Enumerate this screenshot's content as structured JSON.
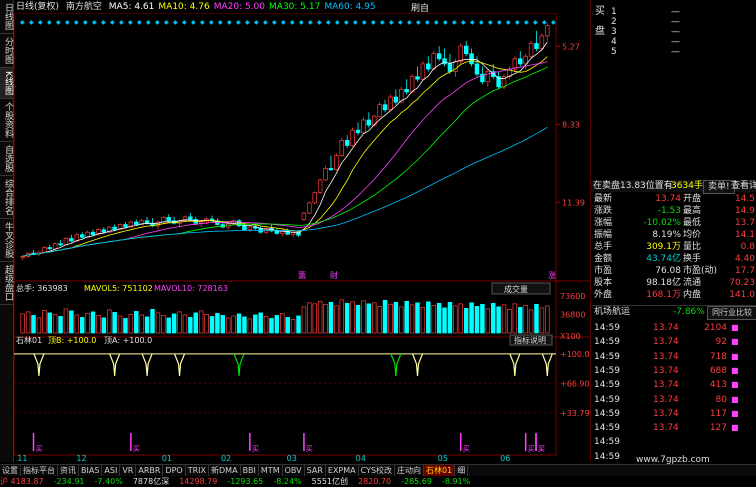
{
  "window": {
    "title": "日线(复权)",
    "stock_name": "南方航空",
    "refresh_label": "刷自"
  },
  "side_tabs": [
    "日线图",
    "分时图",
    "K线图",
    "个股资料",
    "自选股",
    "综合排名",
    "牛叉诊股",
    "超级盘口"
  ],
  "ma_legend": [
    {
      "label": "MA5: 4.61",
      "color": "#ffffff"
    },
    {
      "label": "MA10: 4.76",
      "color": "#ffff00"
    },
    {
      "label": "MA20: 5.00",
      "color": "#ff40ff"
    },
    {
      "label": "MA30: 5.17",
      "color": "#00ff00"
    },
    {
      "label": "MA60: 4.95",
      "color": "#00c0ff"
    }
  ],
  "volume_legend": {
    "total": "总手: 363983",
    "mavol5": "MAVOL5: 751102",
    "mavol10": "MAVOL10: 728163",
    "vol_btn": "成交量"
  },
  "indicator_legend": {
    "name": "石林01",
    "bottom": "顶B: +100.0",
    "top": "顶A: +100.0",
    "explain_btn": "指标说明"
  },
  "price_axis": [
    "11.39",
    "8.33",
    "5.27"
  ],
  "vol_axis": [
    "73600",
    "36800",
    "X100"
  ],
  "ind_axis": [
    "+100.0",
    "+66.90",
    "+33.79"
  ],
  "month_labels": [
    "11",
    "12",
    "01",
    "02",
    "03",
    "04",
    "05",
    "06"
  ],
  "event_marks": [
    {
      "label": "籌"
    },
    {
      "label": "财"
    },
    {
      "label": "涨"
    }
  ],
  "buy_marks": [
    "买",
    "买",
    "买",
    "买",
    "买",
    "买",
    "买",
    "买"
  ],
  "chart_data": [
    {
      "type": "candlestick",
      "title": "",
      "ylim": [
        2.5,
        12.5
      ],
      "ticks": [
        5.27,
        8.33,
        11.39
      ],
      "values": [
        [
          3.1,
          3.2,
          3.0,
          3.15
        ],
        [
          3.15,
          3.3,
          3.1,
          3.28
        ],
        [
          3.28,
          3.4,
          3.2,
          3.25
        ],
        [
          3.25,
          3.35,
          3.18,
          3.32
        ],
        [
          3.32,
          3.55,
          3.3,
          3.5
        ],
        [
          3.5,
          3.6,
          3.4,
          3.45
        ],
        [
          3.45,
          3.7,
          3.42,
          3.65
        ],
        [
          3.65,
          3.8,
          3.55,
          3.6
        ],
        [
          3.6,
          3.9,
          3.58,
          3.85
        ],
        [
          3.85,
          4.0,
          3.7,
          3.75
        ],
        [
          3.75,
          4.05,
          3.72,
          4.0
        ],
        [
          4.0,
          4.1,
          3.85,
          3.9
        ],
        [
          3.9,
          4.15,
          3.88,
          4.1
        ],
        [
          4.1,
          4.2,
          3.95,
          4.0
        ],
        [
          4.0,
          4.25,
          3.98,
          4.2
        ],
        [
          4.2,
          4.3,
          4.05,
          4.1
        ],
        [
          4.1,
          4.35,
          4.08,
          4.3
        ],
        [
          4.3,
          4.4,
          4.15,
          4.2
        ],
        [
          4.2,
          4.45,
          4.18,
          4.4
        ],
        [
          4.4,
          4.5,
          4.25,
          4.3
        ],
        [
          4.3,
          4.55,
          4.28,
          4.5
        ],
        [
          4.5,
          4.6,
          4.35,
          4.4
        ],
        [
          4.4,
          4.62,
          4.38,
          4.55
        ],
        [
          4.55,
          4.7,
          4.4,
          4.45
        ],
        [
          4.45,
          4.65,
          4.3,
          4.35
        ],
        [
          4.35,
          4.55,
          4.2,
          4.5
        ],
        [
          4.5,
          4.72,
          4.45,
          4.68
        ],
        [
          4.68,
          4.8,
          4.5,
          4.55
        ],
        [
          4.55,
          4.7,
          4.4,
          4.45
        ],
        [
          4.45,
          4.6,
          4.3,
          4.55
        ],
        [
          4.55,
          4.75,
          4.5,
          4.7
        ],
        [
          4.7,
          4.85,
          4.55,
          4.6
        ],
        [
          4.6,
          4.7,
          4.4,
          4.45
        ],
        [
          4.45,
          4.58,
          4.3,
          4.5
        ],
        [
          4.5,
          4.68,
          4.42,
          4.62
        ],
        [
          4.62,
          4.75,
          4.5,
          4.55
        ],
        [
          4.55,
          4.65,
          4.35,
          4.4
        ],
        [
          4.4,
          4.55,
          4.25,
          4.3
        ],
        [
          4.3,
          4.48,
          4.2,
          4.42
        ],
        [
          4.42,
          4.6,
          4.38,
          4.55
        ],
        [
          4.55,
          4.62,
          4.3,
          4.35
        ],
        [
          4.35,
          4.45,
          4.15,
          4.2
        ],
        [
          4.2,
          4.38,
          4.1,
          4.3
        ],
        [
          4.3,
          4.45,
          4.18,
          4.25
        ],
        [
          4.25,
          4.35,
          4.05,
          4.1
        ],
        [
          4.1,
          4.3,
          4.02,
          4.25
        ],
        [
          4.25,
          4.4,
          4.1,
          4.15
        ],
        [
          4.15,
          4.28,
          4.0,
          4.05
        ],
        [
          4.05,
          4.2,
          3.95,
          4.15
        ],
        [
          4.15,
          4.25,
          3.98,
          4.02
        ],
        [
          4.02,
          4.15,
          3.9,
          4.1
        ],
        [
          4.1,
          4.18,
          3.92,
          3.98
        ],
        [
          4.6,
          4.9,
          4.55,
          4.85
        ],
        [
          4.85,
          5.3,
          4.8,
          5.25
        ],
        [
          5.25,
          5.7,
          5.2,
          5.65
        ],
        [
          5.65,
          6.2,
          5.6,
          6.15
        ],
        [
          6.15,
          6.7,
          6.1,
          6.6
        ],
        [
          6.6,
          7.1,
          6.5,
          6.55
        ],
        [
          6.55,
          7.2,
          6.5,
          7.1
        ],
        [
          7.1,
          7.8,
          7.05,
          7.7
        ],
        [
          7.7,
          7.9,
          7.4,
          7.5
        ],
        [
          7.5,
          8.2,
          7.45,
          8.1
        ],
        [
          8.1,
          8.4,
          7.9,
          8.0
        ],
        [
          8.0,
          8.6,
          7.95,
          8.5
        ],
        [
          8.5,
          8.8,
          8.2,
          8.3
        ],
        [
          8.3,
          8.7,
          8.25,
          8.65
        ],
        [
          8.65,
          9.2,
          8.6,
          9.1
        ],
        [
          9.1,
          9.3,
          8.8,
          8.9
        ],
        [
          8.9,
          9.5,
          8.85,
          9.4
        ],
        [
          9.4,
          9.7,
          9.1,
          9.2
        ],
        [
          9.2,
          9.8,
          9.15,
          9.7
        ],
        [
          9.7,
          10.1,
          9.5,
          9.6
        ],
        [
          9.6,
          10.3,
          9.55,
          10.2
        ],
        [
          10.2,
          10.6,
          10.0,
          10.1
        ],
        [
          10.1,
          10.8,
          10.05,
          10.7
        ],
        [
          10.7,
          11.0,
          10.4,
          10.5
        ],
        [
          10.5,
          11.2,
          10.45,
          11.1
        ],
        [
          11.1,
          11.4,
          10.8,
          10.9
        ],
        [
          10.9,
          11.3,
          10.6,
          10.7
        ],
        [
          10.7,
          11.1,
          10.3,
          10.4
        ],
        [
          10.4,
          10.9,
          10.2,
          10.8
        ],
        [
          10.8,
          11.5,
          10.7,
          11.4
        ],
        [
          11.4,
          11.6,
          11.0,
          11.1
        ],
        [
          11.1,
          11.3,
          10.6,
          10.7
        ],
        [
          10.7,
          11.0,
          10.2,
          10.3
        ],
        [
          10.3,
          10.6,
          9.9,
          10.0
        ],
        [
          10.0,
          10.5,
          9.8,
          10.4
        ],
        [
          10.4,
          10.7,
          10.1,
          10.2
        ],
        [
          10.2,
          10.4,
          9.7,
          9.8
        ],
        [
          9.8,
          10.3,
          9.7,
          10.2
        ],
        [
          10.2,
          10.6,
          10.1,
          10.5
        ],
        [
          10.5,
          11.0,
          10.4,
          10.9
        ],
        [
          10.9,
          11.2,
          10.6,
          10.7
        ],
        [
          10.7,
          11.1,
          10.5,
          11.0
        ],
        [
          11.0,
          11.6,
          10.9,
          11.5
        ],
        [
          11.5,
          12.0,
          11.2,
          11.3
        ],
        [
          11.3,
          11.9,
          11.2,
          11.8
        ],
        [
          11.8,
          12.3,
          11.6,
          12.2
        ]
      ]
    },
    {
      "type": "bar",
      "title": "",
      "ylim": [
        0,
        73600
      ],
      "ticks": [
        36800,
        73600
      ],
      "values": [
        38000,
        42000,
        35000,
        30000,
        45000,
        40000,
        37000,
        33000,
        48000,
        44000,
        36000,
        31000,
        39000,
        42000,
        35000,
        30000,
        46000,
        41000,
        34000,
        29000,
        37000,
        43000,
        36000,
        32000,
        47000,
        40000,
        35000,
        30000,
        38000,
        42000,
        36000,
        31000,
        40000,
        44000,
        37000,
        33000,
        39000,
        35000,
        30000,
        34000,
        38000,
        32000,
        28000,
        36000,
        40000,
        33000,
        29000,
        35000,
        39000,
        31000,
        27000,
        34000,
        52000,
        60000,
        58000,
        63000,
        57000,
        61000,
        54000,
        66000,
        59000,
        62000,
        55000,
        64000,
        58000,
        60000,
        53000,
        65000,
        57000,
        61000,
        52000,
        63000,
        56000,
        60000,
        51000,
        62000,
        55000,
        59000,
        50000,
        61000,
        54000,
        58000,
        49000,
        60000,
        53000,
        57000,
        48000,
        59000,
        52000,
        56000,
        47000,
        58000,
        51000,
        55000,
        46000,
        57000,
        50000,
        54000
      ]
    },
    {
      "type": "line",
      "title": "",
      "ylim": [
        0,
        110
      ],
      "ticks": [
        33.79,
        66.9,
        100.0
      ],
      "values": [
        100,
        100,
        100,
        100,
        100,
        100,
        100,
        100,
        100,
        100,
        100,
        100,
        100,
        100,
        100,
        100,
        100,
        100,
        100,
        100,
        100,
        100,
        100,
        100,
        100,
        100,
        100,
        100,
        100,
        100,
        100,
        100,
        100,
        100,
        100,
        100,
        100,
        100,
        100,
        100,
        100,
        100,
        100,
        100,
        100,
        100,
        100,
        100,
        100,
        100,
        100,
        100,
        100,
        100,
        100,
        100,
        100,
        100,
        100,
        100,
        100,
        100,
        100,
        100,
        100,
        100,
        100,
        100,
        100,
        100,
        100,
        100,
        100,
        100,
        100,
        100,
        100,
        100,
        100,
        100,
        100,
        100,
        100,
        100,
        100,
        100,
        100,
        100,
        100,
        100,
        100,
        100,
        100,
        100,
        100,
        100,
        100,
        100,
        100,
        100
      ],
      "dips": [
        3,
        17,
        23,
        29,
        40,
        69,
        73,
        91,
        97
      ]
    }
  ],
  "panel": {
    "order_book": [
      {
        "label": "买",
        "n": "1"
      },
      {
        "label": "",
        "n": "2"
      },
      {
        "label": "盘",
        "n": "3"
      },
      {
        "label": "",
        "n": "4"
      },
      {
        "label": "",
        "n": "5"
      }
    ],
    "selling_bar": {
      "left": "在卖盘13.83位置有",
      "qty": "3634手",
      "btn1": "卖单!",
      "btn2": "查看详"
    },
    "stats": [
      {
        "k1": "最新",
        "v1": "13.74",
        "c1": "red",
        "k2": "开盘",
        "v2": "14.5"
      },
      {
        "k1": "涨跌",
        "v1": "-1.53",
        "c1": "grn",
        "k2": "最高",
        "v2": "14.9"
      },
      {
        "k1": "涨幅",
        "v1": "-10.02%",
        "c1": "grn",
        "k2": "最低",
        "v2": "13.7"
      },
      {
        "k1": "振幅",
        "v1": "8.19%",
        "c1": "wht",
        "k2": "均价",
        "v2": "14.1"
      },
      {
        "k1": "总手",
        "v1": "309.1万",
        "c1": "yel",
        "k2": "量比",
        "v2": "0.8"
      },
      {
        "k1": "金额",
        "v1": "43.74亿",
        "c1": "cyn",
        "k2": "换手",
        "v2": "4.40"
      },
      {
        "k1": "市盈",
        "v1": "76.08",
        "c1": "wht",
        "k2": "市盈(动)",
        "v2": "17.7"
      },
      {
        "k1": "股本",
        "v1": "98.18亿",
        "c1": "wht",
        "k2": "流通",
        "v2": "70.23"
      },
      {
        "k1": "外盘",
        "v1": "168.1万",
        "c1": "red",
        "k2": "内盘",
        "v2": "141.0"
      }
    ],
    "sector": {
      "name": "机场航运",
      "change": "-7.86%",
      "btn": "同行业比较"
    },
    "ticks": [
      {
        "time": "14:59",
        "price": "13.74",
        "vol": "2104"
      },
      {
        "time": "14:59",
        "price": "13.74",
        "vol": "92"
      },
      {
        "time": "14:59",
        "price": "13.74",
        "vol": "718"
      },
      {
        "time": "14:59",
        "price": "13.74",
        "vol": "688"
      },
      {
        "time": "14:59",
        "price": "13.74",
        "vol": "413"
      },
      {
        "time": "14:59",
        "price": "13.74",
        "vol": "80"
      },
      {
        "time": "14:59",
        "price": "13.74",
        "vol": "117"
      },
      {
        "time": "14:59",
        "price": "13.74",
        "vol": "127"
      },
      {
        "time": "14:59",
        "price": "",
        "vol": ""
      },
      {
        "time": "14:59",
        "price": "",
        "vol": ""
      }
    ]
  },
  "bottom_tabs": [
    "设置",
    "指标平台",
    "资讯",
    "BIAS",
    "ASI",
    "VR",
    "ARBR",
    "DPO",
    "TRIX",
    "新DMA",
    "BBI",
    "MTM",
    "OBV",
    "SAR",
    "EXPMA",
    "CYS校改",
    "庄动向",
    "石林01",
    "细"
  ],
  "status": [
    {
      "text": "沪 4183.87",
      "color": "#ff3c3c"
    },
    {
      "text": "-234.91",
      "color": "#00e000"
    },
    {
      "text": "-7.40%",
      "color": "#00e000"
    },
    {
      "text": "7878亿深",
      "color": "#e0e0e0"
    },
    {
      "text": "14298.79",
      "color": "#ff3c3c"
    },
    {
      "text": "-1293.65",
      "color": "#00e000"
    },
    {
      "text": "-8.24%",
      "color": "#00e000"
    },
    {
      "text": "5551亿创",
      "color": "#e0e0e0"
    },
    {
      "text": "2820.70",
      "color": "#ff3c3c"
    },
    {
      "text": "-285.69",
      "color": "#00e000"
    },
    {
      "text": "-8.91%",
      "color": "#00e000"
    }
  ],
  "watermark": "www.7gpzb.com"
}
